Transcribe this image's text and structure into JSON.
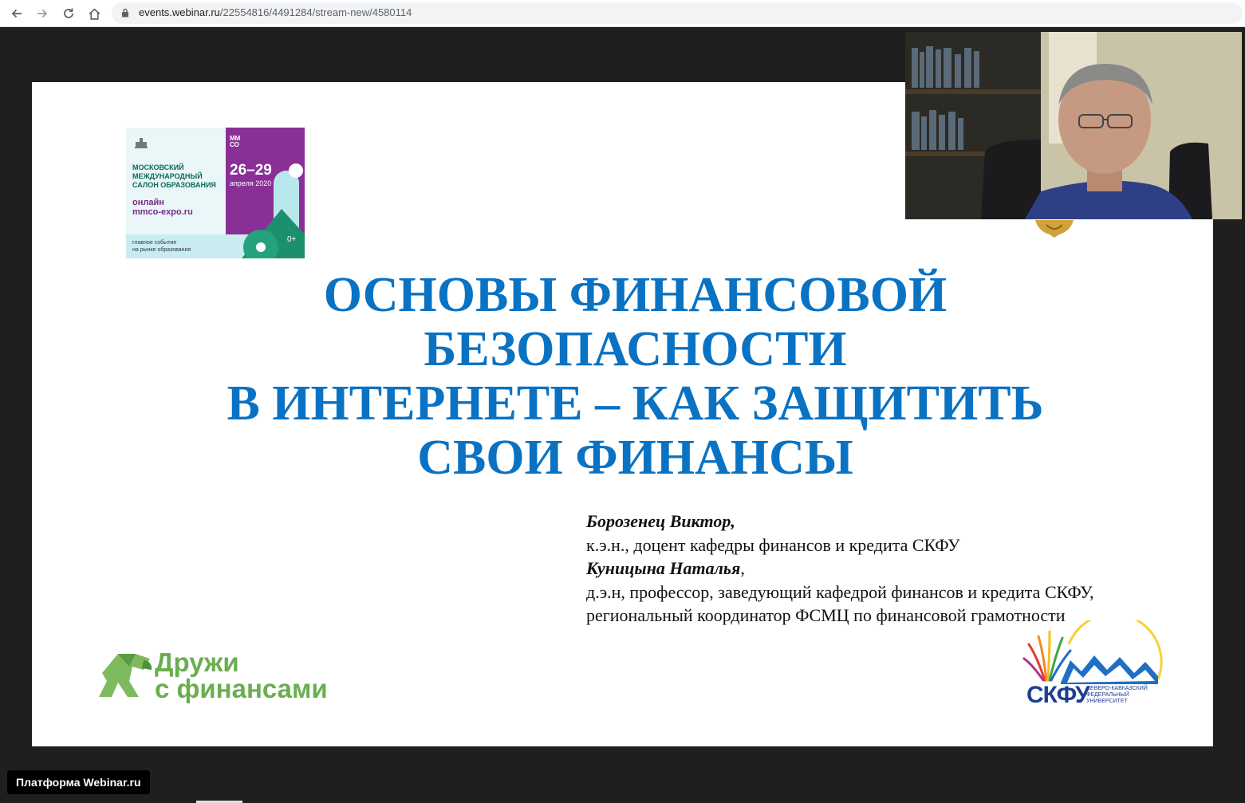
{
  "browser": {
    "url_host": "events.webinar.ru",
    "url_path": "/22554816/4491284/stream-new/4580114",
    "icons": [
      "back-arrow-icon",
      "forward-arrow-icon",
      "reload-icon",
      "home-icon",
      "lock-icon"
    ]
  },
  "slide": {
    "expo": {
      "line1": "МОСКОВСКИЙ",
      "line2": "МЕЖДУНАРОДНЫЙ",
      "line3": "САЛОН ОБРАЗОВАНИЯ",
      "online": "онлайн",
      "site": "mmco-expo.ru",
      "tagline1": "главное событие",
      "tagline2": "на рынке образования",
      "brand_top": "ММ",
      "brand_bottom": "СО",
      "dates": "26–29",
      "month": "апреля 2020",
      "age": "0+"
    },
    "title_lines": [
      "ОСНОВЫ ФИНАНСОВОЙ",
      "БЕЗОПАСНОСТИ",
      "В ИНТЕРНЕТЕ – КАК ЗАЩИТИТЬ",
      "СВОИ ФИНАНСЫ"
    ],
    "authors": [
      {
        "name": "Борозенец Виктор",
        "sep": ","
      },
      {
        "text": "к.э.н., доцент кафедры финансов и кредита СКФУ"
      },
      {
        "name": "Куницына Наталья",
        "sep": ","
      },
      {
        "text": "д.э.н, профессор, заведующий кафедрой финансов и кредита СКФУ,"
      },
      {
        "text": "региональный координатор ФСМЦ по финансовой грамотности"
      }
    ],
    "druzhi": {
      "line1": "Дружи",
      "line2": "с финансами"
    },
    "skfu": {
      "abbr": "СКФУ",
      "full1": "СЕВЕРО-КАВКАЗСКИЙ",
      "full2": "ФЕДЕРАЛЬНЫЙ",
      "full3": "УНИВЕРСИТЕТ"
    }
  },
  "platform_label": "Платформа Webinar.ru",
  "colors": {
    "title_blue": "#0a72c3",
    "expo_purple": "#8a2f96",
    "expo_green": "#0d6b58",
    "druzhi_green": "#6aae4f",
    "skfu_blue": "#1f3f8f",
    "player_bg": "#1f1f1f"
  }
}
